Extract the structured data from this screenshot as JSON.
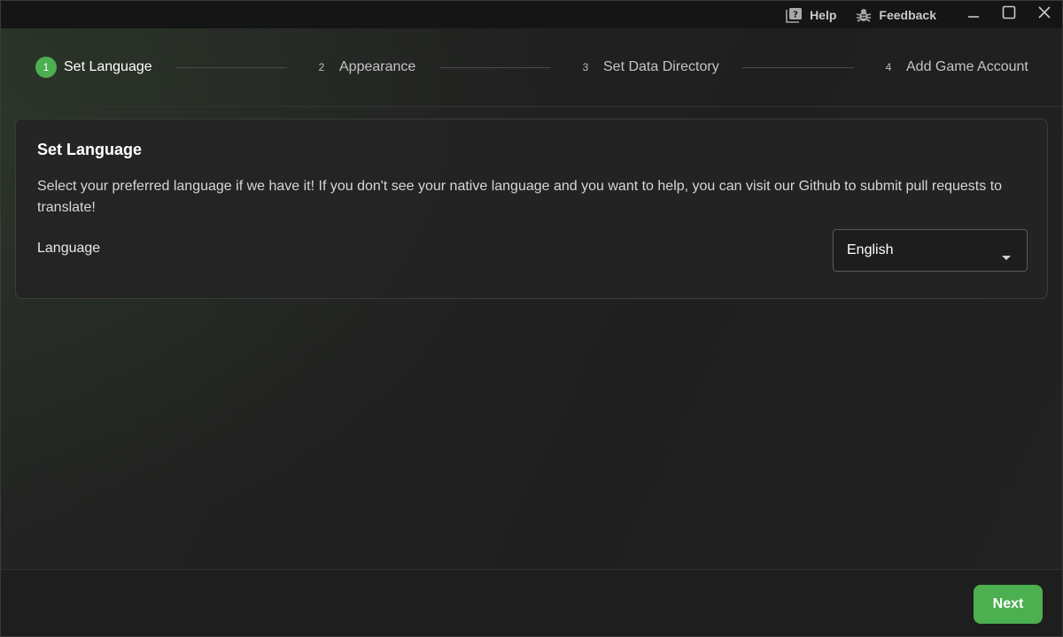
{
  "titlebar": {
    "help_label": "Help",
    "help_icon": "help-book-icon",
    "feedback_label": "Feedback",
    "feedback_icon": "bug-icon",
    "window_controls": [
      "minimize-icon",
      "maximize-icon",
      "close-icon"
    ]
  },
  "stepper": {
    "steps": [
      {
        "number": "1",
        "label": "Set Language",
        "active": true
      },
      {
        "number": "2",
        "label": "Appearance",
        "active": false
      },
      {
        "number": "3",
        "label": "Set Data Directory",
        "active": false
      },
      {
        "number": "4",
        "label": "Add Game Account",
        "active": false
      }
    ]
  },
  "card": {
    "title": "Set Language",
    "description": "Select your preferred language if we have it! If you don't see your native language and you want to help, you can visit our Github to submit pull requests to translate!",
    "language_label": "Language",
    "language_selected": "English",
    "caret_icon": "caret-down-icon"
  },
  "footer": {
    "next_label": "Next"
  },
  "colors": {
    "accent": "#4caf50",
    "background": "#1f1f1f",
    "titlebar": "#151515",
    "text": "#e6e6e6"
  }
}
